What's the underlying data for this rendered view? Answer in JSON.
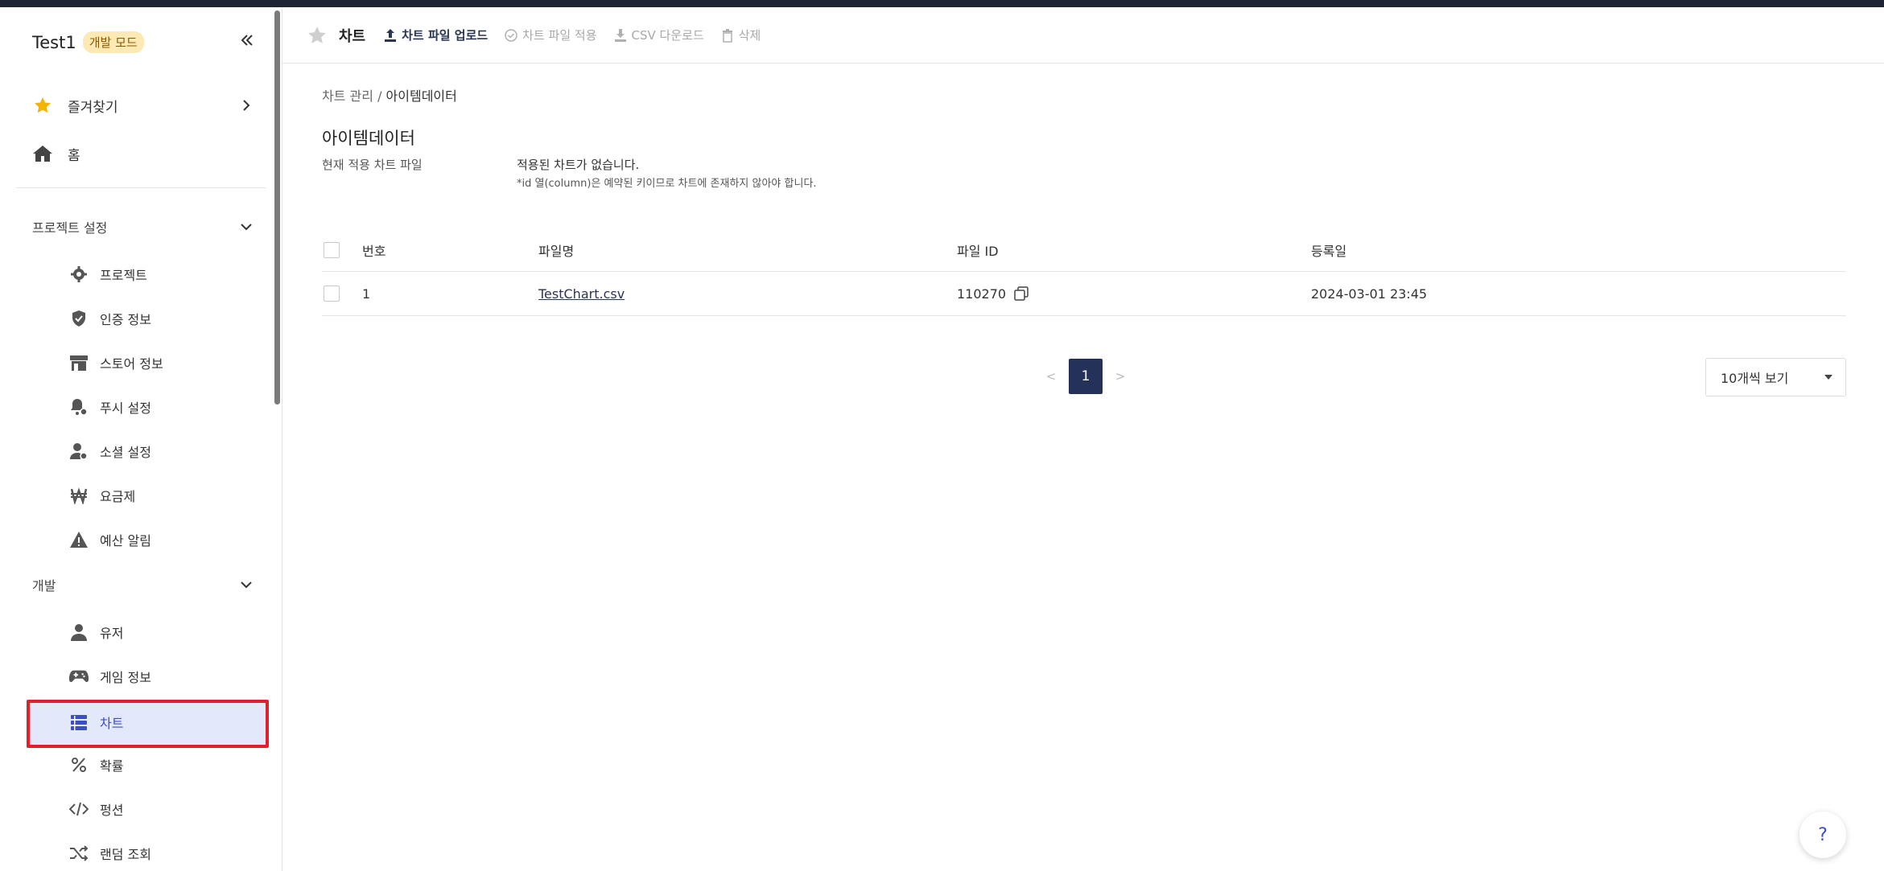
{
  "sidebar": {
    "project_name": "Test1",
    "mode_badge": "개발 모드",
    "favorites": "즐겨찾기",
    "home": "홈",
    "sections": [
      {
        "label": "프로젝트 설정",
        "items": [
          {
            "label": "프로젝트",
            "icon": "gear-icon"
          },
          {
            "label": "인증 정보",
            "icon": "shield-check-icon"
          },
          {
            "label": "스토어 정보",
            "icon": "store-icon"
          },
          {
            "label": "푸시 설정",
            "icon": "bell-gear-icon"
          },
          {
            "label": "소셜 설정",
            "icon": "user-gear-icon"
          },
          {
            "label": "요금제",
            "icon": "won-icon"
          },
          {
            "label": "예산 알림",
            "icon": "warning-icon"
          }
        ]
      },
      {
        "label": "개발",
        "items": [
          {
            "label": "유저",
            "icon": "user-icon"
          },
          {
            "label": "게임 정보",
            "icon": "gamepad-icon"
          },
          {
            "label": "차트",
            "icon": "chart-table-icon",
            "active": true
          },
          {
            "label": "확률",
            "icon": "percent-icon"
          },
          {
            "label": "펑션",
            "icon": "code-icon"
          },
          {
            "label": "랜덤 조회",
            "icon": "shuffle-icon"
          }
        ]
      }
    ]
  },
  "toolbar": {
    "title": "차트",
    "upload": "차트 파일 업로드",
    "apply": "차트 파일 적용",
    "csv": "CSV 다운로드",
    "delete": "삭제"
  },
  "breadcrumb": {
    "parent": "차트 관리",
    "sep": "/",
    "current": "아이템데이터"
  },
  "page": {
    "title": "아이템데이터",
    "info_label": "현재 적용 차트 파일",
    "info_value": "적용된 차트가 없습니다.",
    "info_note": "*id 열(column)은 예약된 키이므로 차트에 존재하지 않아야 합니다."
  },
  "table": {
    "headers": {
      "no": "번호",
      "filename": "파일명",
      "fileid": "파일 ID",
      "date": "등록일"
    },
    "rows": [
      {
        "no": "1",
        "filename": "TestChart.csv",
        "fileid": "110270",
        "date": "2024-03-01 23:45"
      }
    ]
  },
  "pagination": {
    "prev": "<",
    "current": "1",
    "next": ">"
  },
  "page_size": "10개씩 보기",
  "help": "?",
  "colors": {
    "accent": "#243158",
    "active_bg": "#e3e8fb",
    "highlight": "#e0202a",
    "star": "#f5b301"
  }
}
